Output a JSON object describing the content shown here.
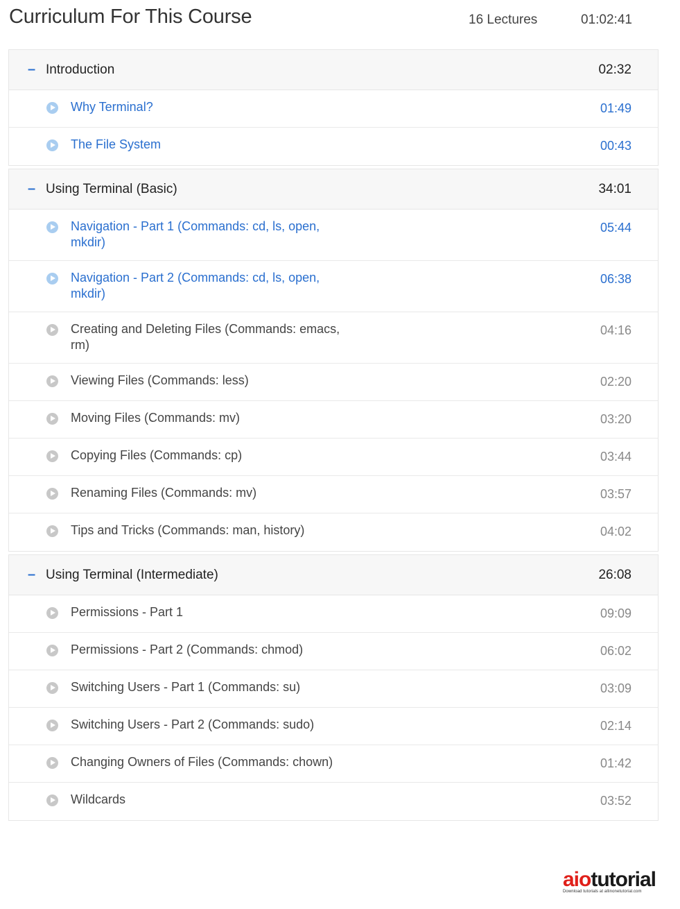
{
  "header": {
    "title": "Curriculum For This Course",
    "lectures_count": "16 Lectures",
    "total_duration": "01:02:41"
  },
  "sections": [
    {
      "title": "Introduction",
      "duration": "02:32",
      "lectures": [
        {
          "title": "Why Terminal?",
          "duration": "01:49",
          "preview": true
        },
        {
          "title": "The File System",
          "duration": "00:43",
          "preview": true
        }
      ]
    },
    {
      "title": "Using Terminal (Basic)",
      "duration": "34:01",
      "lectures": [
        {
          "title": "Navigation - Part 1 (Commands: cd, ls, open, mkdir)",
          "duration": "05:44",
          "preview": true
        },
        {
          "title": "Navigation - Part 2 (Commands: cd, ls, open, mkdir)",
          "duration": "06:38",
          "preview": true
        },
        {
          "title": "Creating and Deleting Files (Commands: emacs, rm)",
          "duration": "04:16",
          "preview": false
        },
        {
          "title": "Viewing Files (Commands: less)",
          "duration": "02:20",
          "preview": false
        },
        {
          "title": "Moving Files (Commands: mv)",
          "duration": "03:20",
          "preview": false
        },
        {
          "title": "Copying Files (Commands: cp)",
          "duration": "03:44",
          "preview": false
        },
        {
          "title": "Renaming Files (Commands: mv)",
          "duration": "03:57",
          "preview": false
        },
        {
          "title": "Tips and Tricks (Commands: man, history)",
          "duration": "04:02",
          "preview": false
        }
      ]
    },
    {
      "title": "Using Terminal (Intermediate)",
      "duration": "26:08",
      "lectures": [
        {
          "title": "Permissions - Part 1",
          "duration": "09:09",
          "preview": false
        },
        {
          "title": "Permissions - Part 2 (Commands: chmod)",
          "duration": "06:02",
          "preview": false
        },
        {
          "title": "Switching Users - Part 1 (Commands: su)",
          "duration": "03:09",
          "preview": false
        },
        {
          "title": "Switching Users - Part 2 (Commands: sudo)",
          "duration": "02:14",
          "preview": false
        },
        {
          "title": "Changing Owners of Files (Commands: chown)",
          "duration": "01:42",
          "preview": false
        },
        {
          "title": "Wildcards",
          "duration": "03:52",
          "preview": false
        }
      ]
    }
  ],
  "icons": {
    "collapse": "minus-icon",
    "lecture": "play-circle-icon"
  },
  "colors": {
    "accent": "#2a6fcf",
    "preview_icon": "#a9cdf0",
    "locked_icon": "#c8c8c8",
    "section_bg": "#f7f7f7"
  },
  "watermark": {
    "logo_a": "aio",
    "logo_b": "tutorial",
    "tagline": "Download tutorials at allinonetutorial.com"
  }
}
